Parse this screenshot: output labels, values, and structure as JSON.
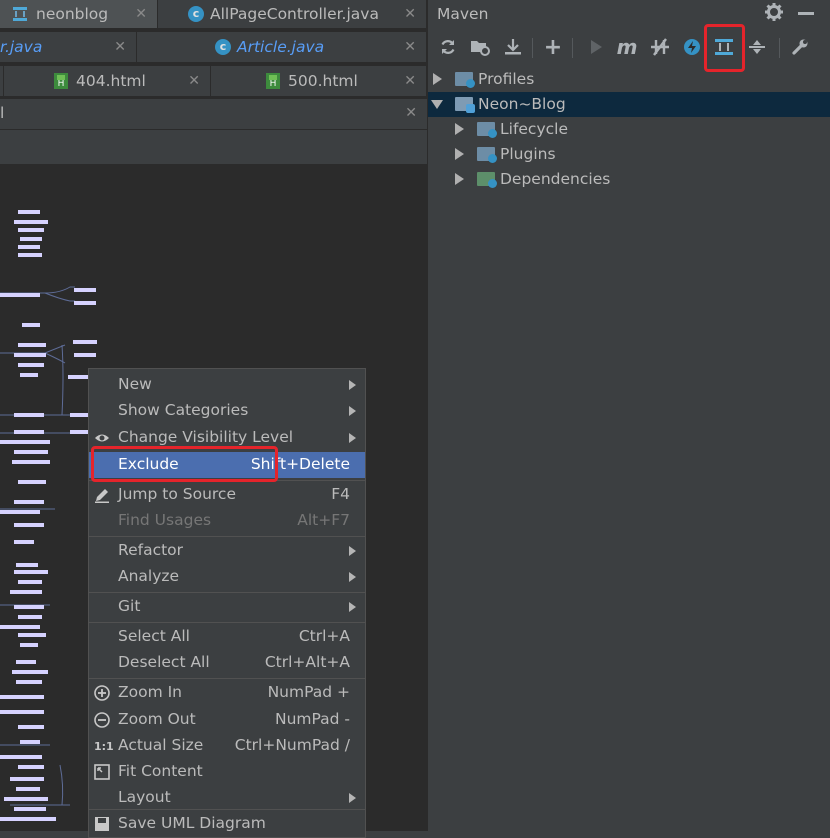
{
  "editor": {
    "tabs_row1": [
      {
        "label": "neonblog",
        "icon": "diagram-icon"
      },
      {
        "label": "AllPageController.java",
        "icon": "class-icon"
      }
    ],
    "tabs_row2": [
      {
        "label": "r.java"
      },
      {
        "label": "Article.java"
      }
    ],
    "tabs_row3": [
      {
        "label": "404.html",
        "icon": "html-file-icon"
      },
      {
        "label": "500.html",
        "icon": "html-file-icon"
      }
    ],
    "tool_title": "l",
    "close_glyph": "✕"
  },
  "maven": {
    "title": "Maven",
    "toolbar": [
      "refresh-icon",
      "add-folder-icon",
      "download-icon",
      "plus-icon",
      "run-icon",
      "maven-goal-icon",
      "skip-tests-icon",
      "offline-icon",
      "show-diagram-icon",
      "collapse-all-icon",
      "settings-wrench-icon"
    ],
    "tree": [
      {
        "label": "Profiles",
        "expanded": false,
        "selected": false,
        "depth": 0
      },
      {
        "label": "Neon~Blog",
        "expanded": true,
        "selected": true,
        "depth": 0
      },
      {
        "label": "Lifecycle",
        "expanded": false,
        "selected": false,
        "depth": 1
      },
      {
        "label": "Plugins",
        "expanded": false,
        "selected": false,
        "depth": 1
      },
      {
        "label": "Dependencies",
        "expanded": false,
        "selected": false,
        "depth": 1
      }
    ]
  },
  "context_menu": {
    "items": [
      {
        "label": "New",
        "shortcut": "",
        "submenu": true
      },
      {
        "label": "Show Categories",
        "shortcut": "",
        "submenu": true
      },
      {
        "label": "Change Visibility Level",
        "shortcut": "",
        "submenu": true,
        "icon": "eye-icon"
      },
      {
        "label": "Exclude",
        "shortcut": "Shift+Delete",
        "highlighted": true
      },
      {
        "label": "Jump to Source",
        "shortcut": "F4",
        "icon": "edit-pencil-icon"
      },
      {
        "label": "Find Usages",
        "shortcut": "Alt+F7",
        "disabled": true
      },
      {
        "label": "Refactor",
        "shortcut": "",
        "submenu": true
      },
      {
        "label": "Analyze",
        "shortcut": "",
        "submenu": true
      },
      {
        "label": "Git",
        "shortcut": "",
        "submenu": true
      },
      {
        "label": "Select All",
        "shortcut": "Ctrl+A"
      },
      {
        "label": "Deselect All",
        "shortcut": "Ctrl+Alt+A"
      },
      {
        "label": "Zoom In",
        "shortcut": "NumPad +",
        "icon": "zoom-in-icon"
      },
      {
        "label": "Zoom Out",
        "shortcut": "NumPad -",
        "icon": "zoom-out-icon"
      },
      {
        "label": "Actual Size",
        "shortcut": "Ctrl+NumPad /",
        "icon": "actual-size-icon"
      },
      {
        "label": "Fit Content",
        "shortcut": "",
        "icon": "fit-content-icon"
      },
      {
        "label": "Layout",
        "shortcut": "",
        "submenu": true
      },
      {
        "label": "Save UML Diagram",
        "shortcut": "",
        "icon": "save-icon"
      }
    ]
  }
}
